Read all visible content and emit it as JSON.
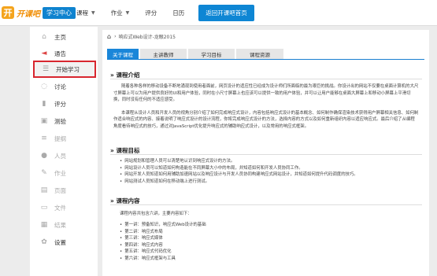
{
  "header": {
    "logo_text": "开课吧",
    "logo_badge": "学习中心",
    "nav": [
      {
        "label": "课程",
        "has_caret": true
      },
      {
        "label": "作业",
        "has_caret": true
      },
      {
        "label": "评分",
        "has_caret": false
      },
      {
        "label": "日历",
        "has_caret": false
      }
    ],
    "home_button": "返回开课吧首页"
  },
  "sidebar": {
    "items": [
      {
        "label": "主页",
        "icon": "home-icon"
      },
      {
        "label": "通告",
        "icon": "megaphone-icon"
      },
      {
        "label": "开始学习",
        "icon": "list-icon",
        "active": true
      },
      {
        "label": "讨论",
        "icon": "chat-icon"
      },
      {
        "label": "评分",
        "icon": "bar-chart-icon"
      },
      {
        "label": "测验",
        "icon": "quiz-icon"
      },
      {
        "label": "提纲",
        "icon": "outline-icon",
        "muted": true
      },
      {
        "label": "人员",
        "icon": "people-icon",
        "muted": true
      },
      {
        "label": "作业",
        "icon": "edit-icon",
        "muted": true
      },
      {
        "label": "页面",
        "icon": "page-icon",
        "muted": true
      },
      {
        "label": "文件",
        "icon": "folder-icon",
        "muted": true
      },
      {
        "label": "结果",
        "icon": "results-icon",
        "muted": true
      },
      {
        "label": "设置",
        "icon": "gear-icon"
      }
    ]
  },
  "breadcrumb": "响应式Web设计-龙眼2015",
  "tabs": [
    "关于课程",
    "主讲教师",
    "学习目标",
    "课程资源"
  ],
  "sections": {
    "intro": {
      "title": "» 课程介绍",
      "paragraphs": [
        "随着各种各样的移动设备不断地涌现到使用者面前，网页设计的适应性已经成为设计师们所面临的最为艰巨的挑战。你设计出的网站不仅要在桌面计算机的大尺寸屏幕上可以为用户提供良好的UI和用户体验，同时在小尺寸屏幕上也应该可以提供一致的用户体验，并可以让用户能够在桌面大屏幕上和移动小屏幕上平滑切换，同时没有任何的不适应感受。",
        "本课程从设计人员和开发人员的视角分别介绍了如何完成响应式设计，内容包括响应式设计的基本概念、如何制作确保渲染技术获得用户屏幕相关信息、如何制作适合响应式的内容、接着说明了响应式设计的设计流程，你将完成响应式设计的方法，选择内容的方式以及如何重新组织内容以适应响应式。最后介绍了从编程角度看待响应式的技巧，通过对JavaScript优化提升响应式的辅助响应式设计，以及常用的响应式框架。"
      ]
    },
    "goals": {
      "title": "» 课程目标",
      "items": [
        "网站规划和管理人员可以清楚地认识到响应式设计的方法。",
        "网站设计人员可以知道如何构造能在不同屏幕大小中的布局，并知道如何和开发人员协同工作。",
        "网站开发人员知道如何用辅助加速网站以及响应设计与开发人员协同构建响应式网站设计，并知道如何提升代码调度的技巧。",
        "网站测试人员知道如何在移动端上进行测试。"
      ]
    },
    "content": {
      "title": "» 课程内容",
      "intro": "课程内容共包含六讲，主要内容如下：",
      "items": [
        "第一讲：预备知识，响应式Web设计的基础",
        "第二讲：响应式布局",
        "第三讲：响应式媒体",
        "第四讲：响应式内容",
        "第五讲：响应式代码优化",
        "第六讲：响应式框架与工具"
      ]
    }
  },
  "colors": {
    "brand_blue": "#0e86d4",
    "logo_orange": "#f4a41d",
    "active_outline": "#d8262f"
  }
}
